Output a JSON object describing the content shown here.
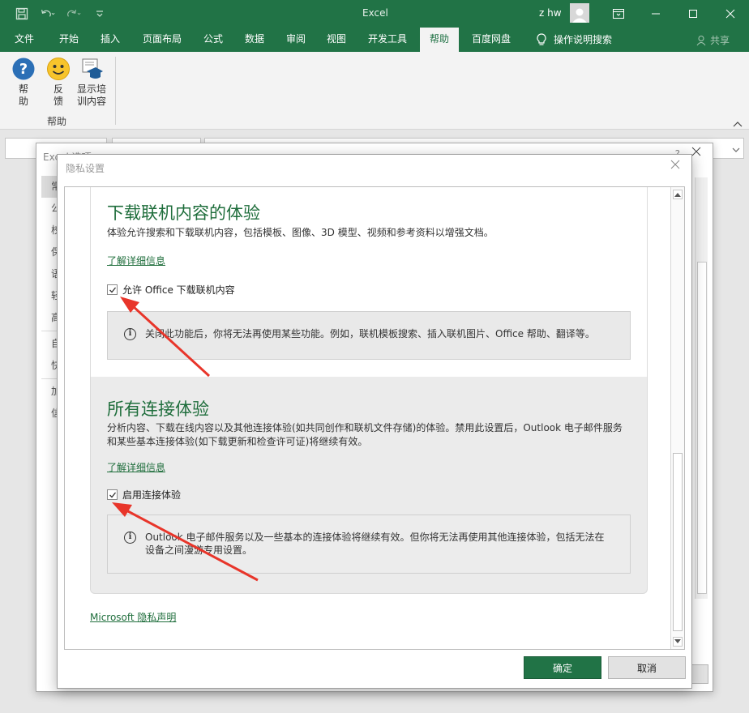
{
  "window": {
    "app_title": "Excel",
    "user_name": "z hw"
  },
  "ribbon_tabs": [
    {
      "label": "文件"
    },
    {
      "label": "开始"
    },
    {
      "label": "插入"
    },
    {
      "label": "页面布局"
    },
    {
      "label": "公式"
    },
    {
      "label": "数据"
    },
    {
      "label": "审阅"
    },
    {
      "label": "视图"
    },
    {
      "label": "开发工具"
    },
    {
      "label": "帮助"
    },
    {
      "label": "百度网盘"
    }
  ],
  "tell_me": "操作说明搜索",
  "share_label": "共享",
  "help_group": {
    "help_label": "帮\n助",
    "feedback_label": "反\n馈",
    "training_label": "显示培\n训内容",
    "group_name": "帮助"
  },
  "options_dialog": {
    "title": "Excel 选项",
    "help": "?",
    "nav": [
      "常",
      "公",
      "校",
      "保",
      "语",
      "轻",
      "高",
      "自",
      "快",
      "加",
      "信"
    ]
  },
  "privacy_dialog": {
    "title": "隐私设置",
    "section1": {
      "heading": "下载联机内容的体验",
      "description": "体验允许搜索和下载联机内容，包括模板、图像、3D 模型、视频和参考资料以增强文档。",
      "learn_more": "了解详细信息",
      "checkbox_label": "允许 Office 下载联机内容",
      "checked": true,
      "info": "关闭此功能后，你将无法再使用某些功能。例如，联机模板搜索、插入联机图片、Office 帮助、翻译等。"
    },
    "section2": {
      "heading": "所有连接体验",
      "description_line1": "分析内容、下载在线内容以及其他连接体验(如共同创作和联机文件存储)的体验。禁用此设置后，Outlook 电子邮件服务",
      "description_line2": "和某些基本连接体验(如下载更新和检查许可证)将继续有效。",
      "learn_more": "了解详细信息",
      "checkbox_label": "启用连接体验",
      "checked": true,
      "info_line1": "Outlook 电子邮件服务以及一些基本的连接体验将继续有效。但你将无法再使用其他连接体验，包括无法在",
      "info_line2": "设备之间漫游专用设置。"
    },
    "privacy_statement_link": "Microsoft 隐私声明",
    "ok_label": "确定",
    "cancel_label": "取消"
  },
  "colors": {
    "accent": "#217346",
    "heading_green": "#1f6e3c",
    "annotation_red": "#e8352a"
  }
}
